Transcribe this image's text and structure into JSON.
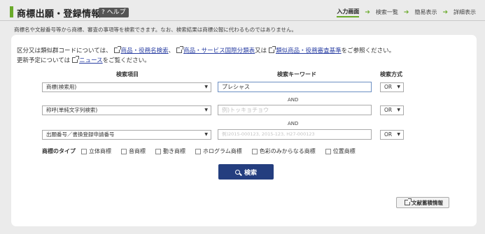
{
  "header": {
    "title": "商標出願・登録情報",
    "help_label": "? ヘルプ",
    "steps": [
      {
        "label": "入力画面",
        "active": true
      },
      {
        "label": "検索一覧",
        "active": false
      },
      {
        "label": "簡易表示",
        "active": false
      },
      {
        "label": "詳細表示",
        "active": false
      }
    ],
    "description": "商標名や文献番号等から商標、審査の事項等を検索できます。なお、検索結果は商標公報に代わるものではありません。"
  },
  "info": {
    "line1_prefix": "区分又は類似群コードについては、",
    "link1": "商品・役務名検索",
    "sep1": "、",
    "link2": "商品・サービス国際分類表",
    "sep2": "又は",
    "link3": "類似商品・役務審査基準",
    "line1_suffix": "をご参照ください。",
    "line2_prefix": "更新予定については",
    "link4": "ニュース",
    "line2_suffix": "をご覧ください。"
  },
  "columns": {
    "item": "検索項目",
    "keyword": "検索キーワード",
    "method": "検索方式"
  },
  "rows": [
    {
      "item": "商標(検索用)",
      "keyword_value": "プレシャス",
      "keyword_placeholder": "",
      "method": "OR"
    },
    {
      "item": "称呼(単純文字列検索)",
      "keyword_value": "",
      "keyword_placeholder": "例)トッキョチョウ",
      "method": "OR"
    },
    {
      "item": "出願番号／書換登録申請番号",
      "keyword_value": "",
      "keyword_placeholder": "例)2015-000123, 2015-123, H27-000123",
      "method": "OR"
    }
  ],
  "and_label": "AND",
  "mark_types": {
    "title": "商標のタイプ",
    "options": [
      "立体商標",
      "音商標",
      "動き商標",
      "ホログラム商標",
      "色彩のみからなる商標",
      "位置商標"
    ]
  },
  "search_button": "検索",
  "doc_button": "文献蓄積情報",
  "colors": {
    "accent": "#6aaa2a",
    "button": "#243e7f",
    "link": "#2a3fa3"
  }
}
